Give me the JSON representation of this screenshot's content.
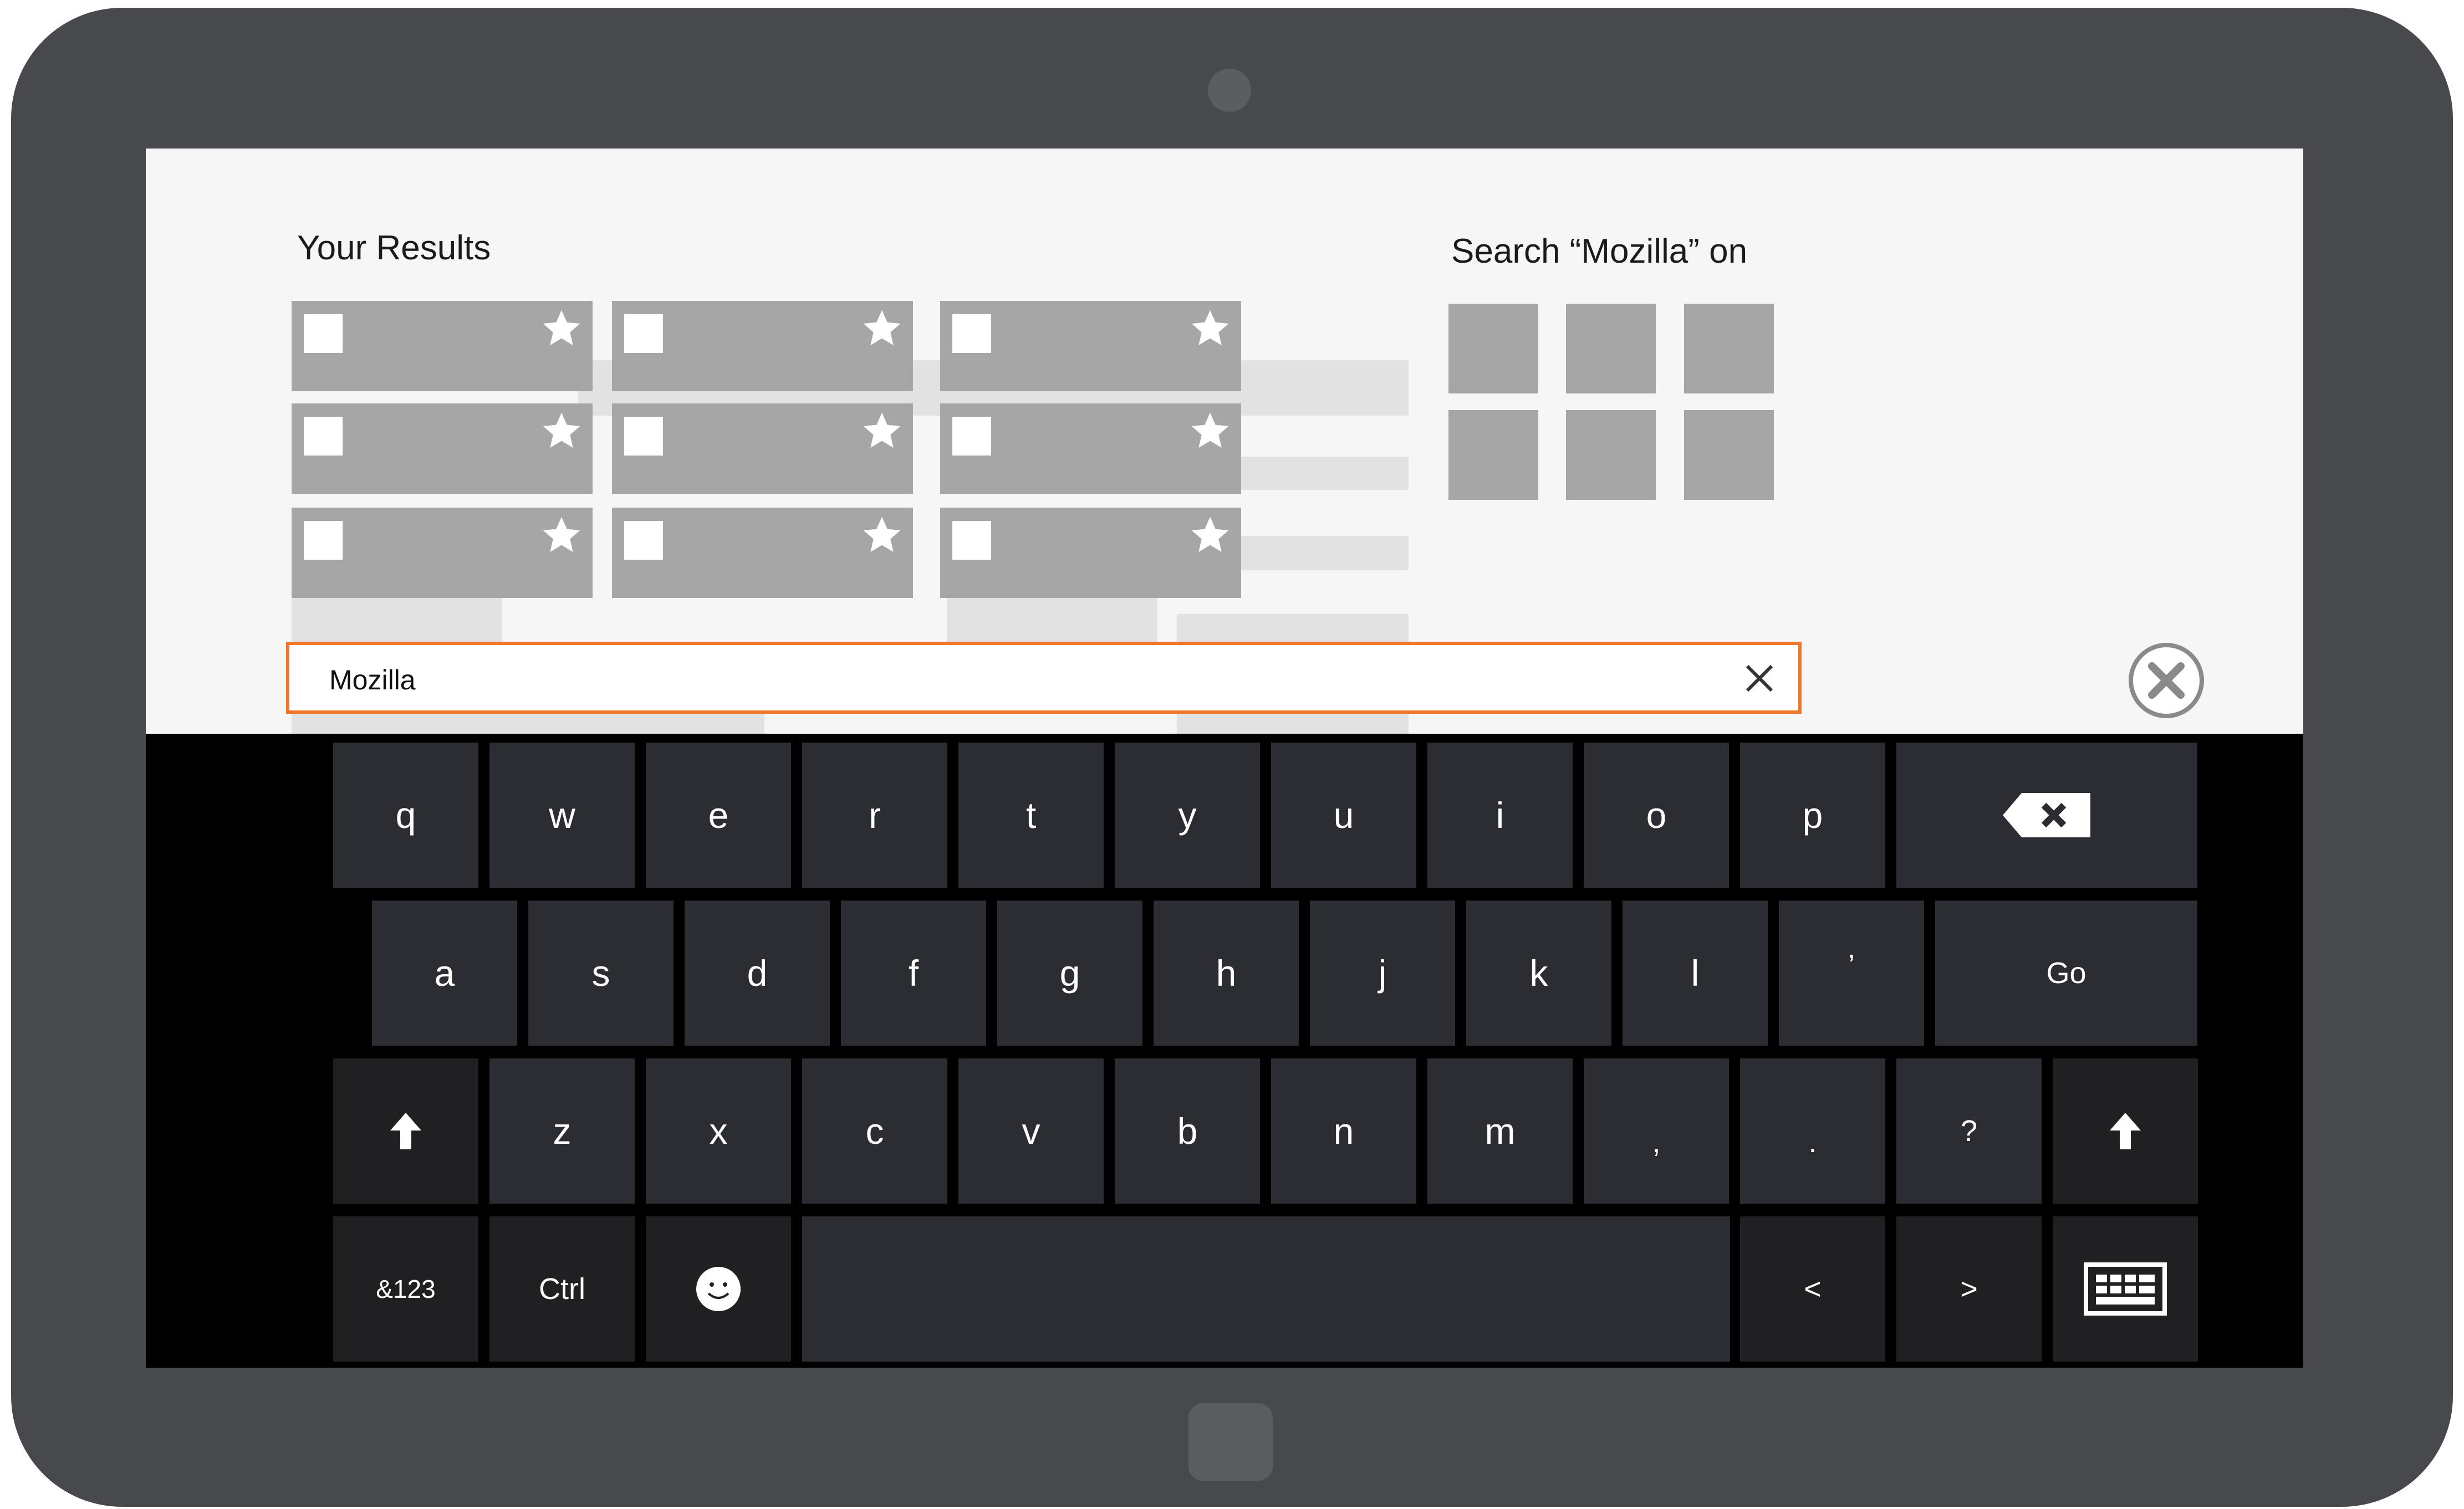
{
  "results": {
    "title": "Your Results"
  },
  "search_on": {
    "title": "Search “Mozilla” on"
  },
  "search": {
    "value": "Mozilla"
  },
  "keyboard": {
    "row1": [
      "q",
      "w",
      "e",
      "r",
      "t",
      "y",
      "u",
      "i",
      "o",
      "p"
    ],
    "row2": [
      "a",
      "s",
      "d",
      "f",
      "g",
      "h",
      "j",
      "k",
      "l",
      "’"
    ],
    "go_label": "Go",
    "row3": [
      "z",
      "x",
      "c",
      "v",
      "b",
      "n",
      "m",
      ",",
      ".",
      "?"
    ],
    "numbers_label": "&123",
    "ctrl_label": "Ctrl",
    "left_label": "<",
    "right_label": ">"
  },
  "icons": {
    "backspace": "backspace-icon",
    "shift": "shift-arrow-icon",
    "emoji": "smiley-icon",
    "keyboard": "keyboard-icon",
    "star": "star-icon",
    "clear": "close-icon",
    "dismiss": "circle-close-icon"
  },
  "colors": {
    "device_bezel": "#48494d",
    "screen_bg": "#f6f6f6",
    "search_border": "#f0772a",
    "tile": "#a6a6a6",
    "keyboard_bg": "#000000",
    "key": "#2c2c33",
    "key_dark": "#202023"
  }
}
